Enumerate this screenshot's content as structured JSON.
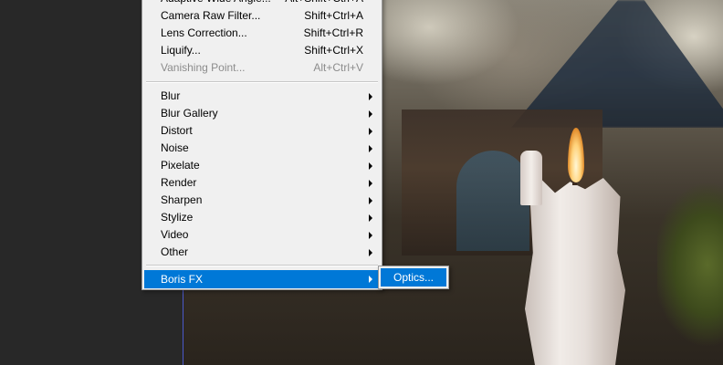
{
  "menu": {
    "items_top": [
      {
        "label": "Adaptive Wide Angle...",
        "shortcut": "Alt+Shift+Ctrl+A",
        "enabled": true
      },
      {
        "label": "Camera Raw Filter...",
        "shortcut": "Shift+Ctrl+A",
        "enabled": true
      },
      {
        "label": "Lens Correction...",
        "shortcut": "Shift+Ctrl+R",
        "enabled": true
      },
      {
        "label": "Liquify...",
        "shortcut": "Shift+Ctrl+X",
        "enabled": true
      },
      {
        "label": "Vanishing Point...",
        "shortcut": "Alt+Ctrl+V",
        "enabled": false
      }
    ],
    "submenus": [
      {
        "label": "Blur"
      },
      {
        "label": "Blur Gallery"
      },
      {
        "label": "Distort"
      },
      {
        "label": "Noise"
      },
      {
        "label": "Pixelate"
      },
      {
        "label": "Render"
      },
      {
        "label": "Sharpen"
      },
      {
        "label": "Stylize"
      },
      {
        "label": "Video"
      },
      {
        "label": "Other"
      }
    ],
    "plugin": {
      "label": "Boris FX",
      "highlighted": true
    }
  },
  "submenu": {
    "items": [
      {
        "label": "Optics...",
        "highlighted": true
      }
    ]
  },
  "colors": {
    "menu_bg": "#f0f0f0",
    "highlight": "#0078d7",
    "disabled_text": "#8c8c8c"
  }
}
